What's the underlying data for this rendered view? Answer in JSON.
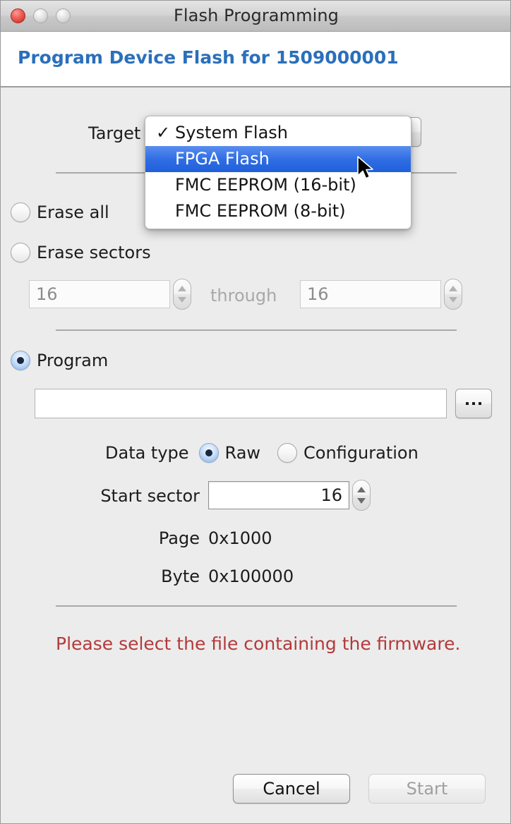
{
  "window": {
    "title": "Flash Programming",
    "traffic_lights": [
      "close",
      "minimize",
      "maximize"
    ]
  },
  "header": {
    "title_prefix": "Program Device Flash for ",
    "device_id": "1509000001",
    "accent_color": "#2a6fbb"
  },
  "target": {
    "label": "Target",
    "selected_value": "System Flash",
    "dropdown_open": true,
    "checkmark": "✓",
    "options": [
      {
        "label": "System Flash",
        "checked": true,
        "highlighted": false
      },
      {
        "label": "FPGA Flash",
        "checked": false,
        "highlighted": true
      },
      {
        "label": "FMC EEPROM (16-bit)",
        "checked": false,
        "highlighted": false
      },
      {
        "label": "FMC EEPROM (8-bit)",
        "checked": false,
        "highlighted": false
      }
    ],
    "highlight_color": "#2f6de3"
  },
  "erase_all": {
    "label": "Erase all",
    "selected": false
  },
  "erase_sectors": {
    "label": "Erase sectors",
    "selected": false,
    "from_value": "16",
    "through_label": "through",
    "to_value": "16",
    "enabled": false
  },
  "program": {
    "label": "Program",
    "selected": true,
    "file_path": "",
    "browse_label": "•••"
  },
  "data_type": {
    "label": "Data type",
    "options": [
      {
        "label": "Raw",
        "selected": true
      },
      {
        "label": "Configuration",
        "selected": false
      }
    ]
  },
  "start_sector": {
    "label": "Start sector",
    "value": "16"
  },
  "page_info": {
    "label": "Page",
    "value": "0x1000"
  },
  "byte_info": {
    "label": "Byte",
    "value": "0x100000"
  },
  "status": {
    "message": "Please select the file containing the firmware.",
    "color": "#b33a3a"
  },
  "footer": {
    "cancel_label": "Cancel",
    "start_label": "Start",
    "start_enabled": false
  }
}
